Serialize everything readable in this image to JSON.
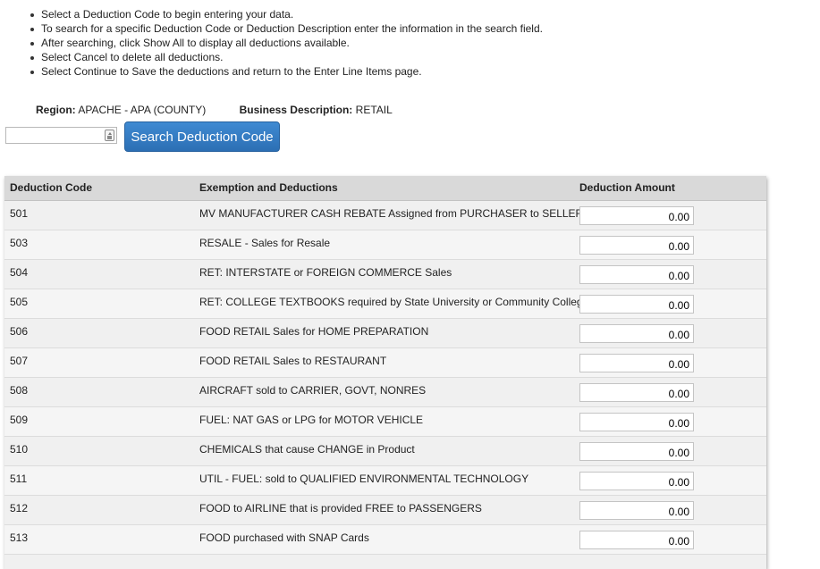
{
  "instructions": [
    "Select a Deduction Code to begin entering your data.",
    "To search for a specific Deduction Code or Deduction Description enter the information in the search field.",
    "After searching, click Show All to display all deductions available.",
    "Select Cancel to delete all deductions.",
    "Select Continue to Save the deductions and return to the Enter Line Items page."
  ],
  "region": {
    "label": "Region:",
    "value": "APACHE - APA (COUNTY)"
  },
  "business": {
    "label": "Business Description:",
    "value": "RETAIL"
  },
  "search": {
    "value": "",
    "button_label": "Search Deduction Code",
    "icon": "keyboard-icon"
  },
  "table": {
    "headers": {
      "code": "Deduction Code",
      "desc": "Exemption and Deductions",
      "amount": "Deduction Amount"
    },
    "rows": [
      {
        "code": "501",
        "desc": "MV MANUFACTURER CASH REBATE Assigned from PURCHASER to SELLER",
        "amount": "0.00"
      },
      {
        "code": "503",
        "desc": "RESALE - Sales for Resale",
        "amount": "0.00"
      },
      {
        "code": "504",
        "desc": "RET: INTERSTATE or FOREIGN COMMERCE Sales",
        "amount": "0.00"
      },
      {
        "code": "505",
        "desc": "RET: COLLEGE TEXTBOOKS required by State University or Community College",
        "amount": "0.00"
      },
      {
        "code": "506",
        "desc": "FOOD RETAIL Sales for HOME PREPARATION",
        "amount": "0.00"
      },
      {
        "code": "507",
        "desc": "FOOD RETAIL Sales to RESTAURANT",
        "amount": "0.00"
      },
      {
        "code": "508",
        "desc": "AIRCRAFT sold to CARRIER, GOVT, NONRES",
        "amount": "0.00"
      },
      {
        "code": "509",
        "desc": "FUEL: NAT GAS or LPG for MOTOR VEHICLE",
        "amount": "0.00"
      },
      {
        "code": "510",
        "desc": "CHEMICALS that cause CHANGE in Product",
        "amount": "0.00"
      },
      {
        "code": "511",
        "desc": "UTIL - FUEL: sold to QUALIFIED ENVIRONMENTAL TECHNOLOGY",
        "amount": "0.00"
      },
      {
        "code": "512",
        "desc": "FOOD to AIRLINE that is provided FREE to PASSENGERS",
        "amount": "0.00"
      },
      {
        "code": "513",
        "desc": "FOOD purchased with SNAP Cards",
        "amount": "0.00"
      }
    ]
  }
}
